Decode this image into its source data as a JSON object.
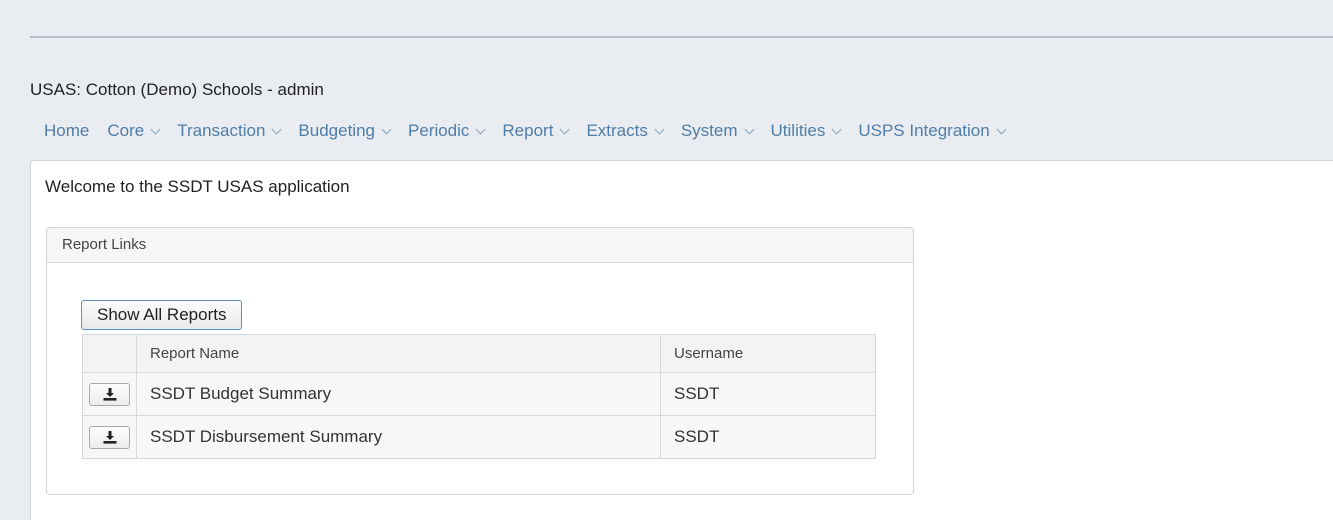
{
  "header": {
    "app_title": "USAS:  Cotton (Demo) Schools  -  admin"
  },
  "nav": {
    "items": [
      {
        "label": "Home",
        "dropdown": false
      },
      {
        "label": "Core",
        "dropdown": true
      },
      {
        "label": "Transaction",
        "dropdown": true
      },
      {
        "label": "Budgeting",
        "dropdown": true
      },
      {
        "label": "Periodic",
        "dropdown": true
      },
      {
        "label": "Report",
        "dropdown": true
      },
      {
        "label": "Extracts",
        "dropdown": true
      },
      {
        "label": "System",
        "dropdown": true
      },
      {
        "label": "Utilities",
        "dropdown": true
      },
      {
        "label": "USPS Integration",
        "dropdown": true
      }
    ]
  },
  "main": {
    "welcome": "Welcome to the SSDT USAS application",
    "report_links": {
      "title": "Report Links",
      "show_all_label": "Show All Reports",
      "columns": [
        "",
        "Report Name",
        "Username"
      ],
      "rows": [
        {
          "icon": "download-icon",
          "name": "SSDT Budget Summary",
          "username": "SSDT"
        },
        {
          "icon": "download-icon",
          "name": "SSDT Disbursement Summary",
          "username": "SSDT"
        }
      ]
    }
  },
  "colors": {
    "nav_link": "#4f7ea8",
    "page_bg": "#e9ecf0",
    "button_border": "#5b8fc1"
  }
}
